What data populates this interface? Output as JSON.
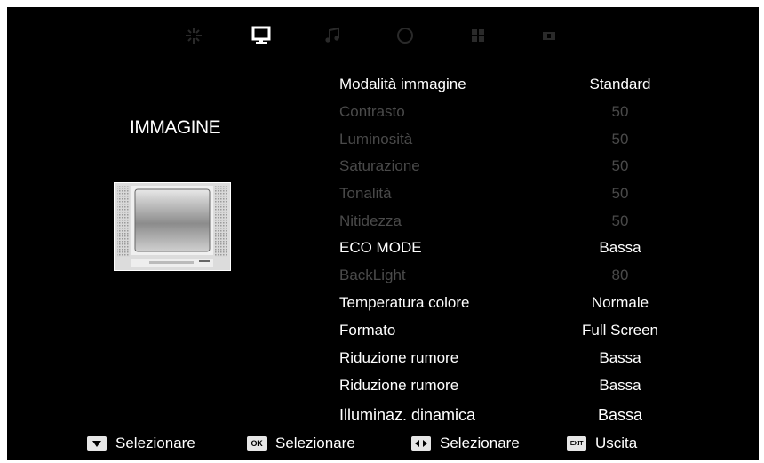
{
  "tabs": [
    {
      "name": "sparkle-icon",
      "active": false
    },
    {
      "name": "monitor-icon",
      "active": true
    },
    {
      "name": "music-note-icon",
      "active": false
    },
    {
      "name": "circle-icon",
      "active": false
    },
    {
      "name": "grid-icon",
      "active": false
    },
    {
      "name": "lock-icon",
      "active": false
    }
  ],
  "section_title": "IMMAGINE",
  "settings": [
    {
      "label": "Modalità immagine",
      "value": "Standard",
      "enabled": true
    },
    {
      "label": "Contrasto",
      "value": "50",
      "enabled": false
    },
    {
      "label": "Luminosità",
      "value": "50",
      "enabled": false
    },
    {
      "label": "Saturazione",
      "value": "50",
      "enabled": false
    },
    {
      "label": "Tonalità",
      "value": "50",
      "enabled": false
    },
    {
      "label": "Nitidezza",
      "value": "50",
      "enabled": false
    },
    {
      "label": "ECO MODE",
      "value": "Bassa",
      "enabled": true
    },
    {
      "label": "BackLight",
      "value": "80",
      "enabled": false
    },
    {
      "label": "Temperatura colore",
      "value": "Normale",
      "enabled": true
    },
    {
      "label": "Formato",
      "value": "Full Screen",
      "enabled": true
    },
    {
      "label": "Riduzione rumore",
      "value": "Bassa",
      "enabled": true
    },
    {
      "label": "Riduzione rumore",
      "value": "Bassa",
      "enabled": true
    },
    {
      "label": "Illuminaz. dinamica",
      "value": "Bassa",
      "enabled": true
    }
  ],
  "footer": {
    "select_down": "Selezionare",
    "ok_key": "OK",
    "ok_select": "Selezionare",
    "select_lr": "Selezionare",
    "exit_key": "EXIT",
    "exit": "Uscita"
  },
  "colors": {
    "background": "#000000",
    "text_enabled": "#ffffff",
    "text_disabled": "#4a4a4a",
    "icon_inactive": "#2a2a2a",
    "icon_active": "#ffffff"
  }
}
